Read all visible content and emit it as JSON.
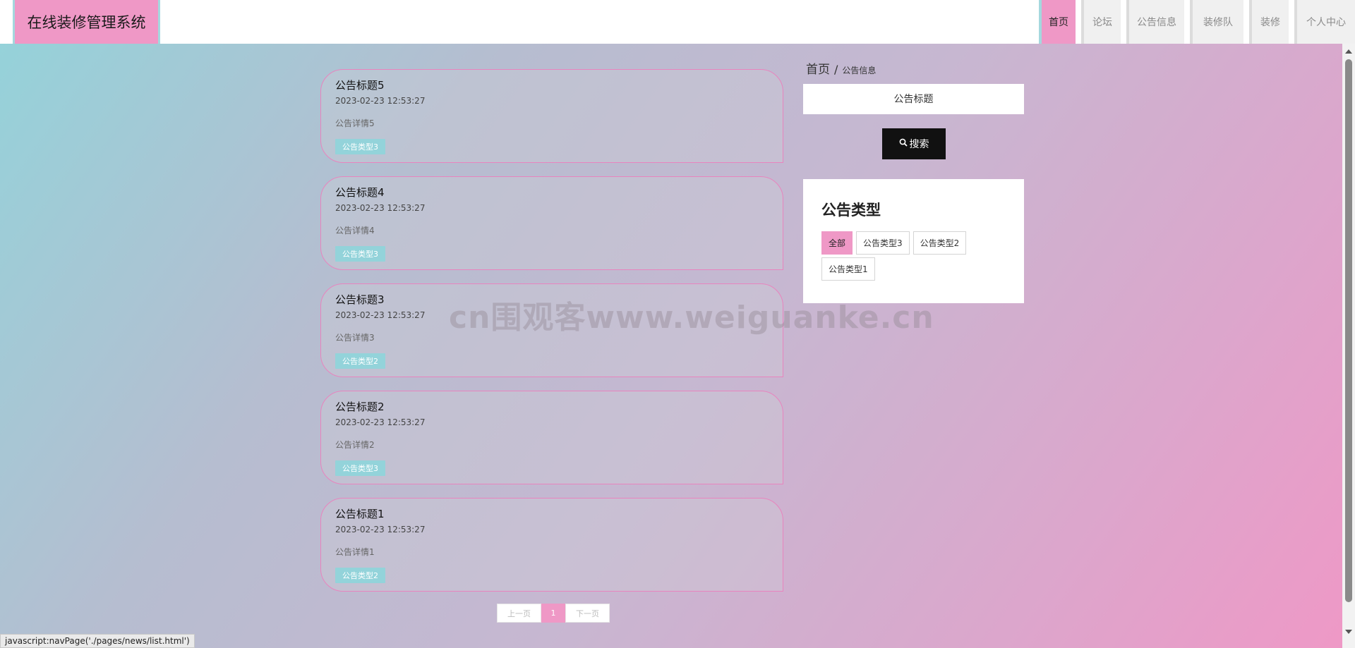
{
  "app": {
    "title": "在线装修管理系统"
  },
  "nav": {
    "items": [
      {
        "label": "首页",
        "active": true
      },
      {
        "label": "论坛",
        "active": false
      },
      {
        "label": "公告信息",
        "active": false
      },
      {
        "label": "装修队",
        "active": false
      },
      {
        "label": "装修",
        "active": false
      },
      {
        "label": "个人中心",
        "active": false
      }
    ]
  },
  "breadcrumb": {
    "home": "首页",
    "separator": "/",
    "current": "公告信息"
  },
  "search": {
    "placeholder": "公告标题",
    "button_label": "搜索"
  },
  "types": {
    "heading": "公告类型",
    "items": [
      {
        "label": "全部",
        "active": true
      },
      {
        "label": "公告类型3",
        "active": false
      },
      {
        "label": "公告类型2",
        "active": false
      },
      {
        "label": "公告类型1",
        "active": false
      }
    ]
  },
  "news": [
    {
      "title": "公告标题5",
      "time": "2023-02-23 12:53:27",
      "detail": "公告详情5",
      "type": "公告类型3"
    },
    {
      "title": "公告标题4",
      "time": "2023-02-23 12:53:27",
      "detail": "公告详情4",
      "type": "公告类型3"
    },
    {
      "title": "公告标题3",
      "time": "2023-02-23 12:53:27",
      "detail": "公告详情3",
      "type": "公告类型2"
    },
    {
      "title": "公告标题2",
      "time": "2023-02-23 12:53:27",
      "detail": "公告详情2",
      "type": "公告类型3"
    },
    {
      "title": "公告标题1",
      "time": "2023-02-23 12:53:27",
      "detail": "公告详情1",
      "type": "公告类型2"
    }
  ],
  "pagination": {
    "prev": "上一页",
    "current": "1",
    "next": "下一页"
  },
  "watermark": "cn围观客www.weiguanke.cn",
  "status_bar": "javascript:navPage('./pages/news/list.html')",
  "colors": {
    "accent_pink": "#ef98c6",
    "accent_teal": "#93d3da",
    "dark_button": "#111111"
  }
}
